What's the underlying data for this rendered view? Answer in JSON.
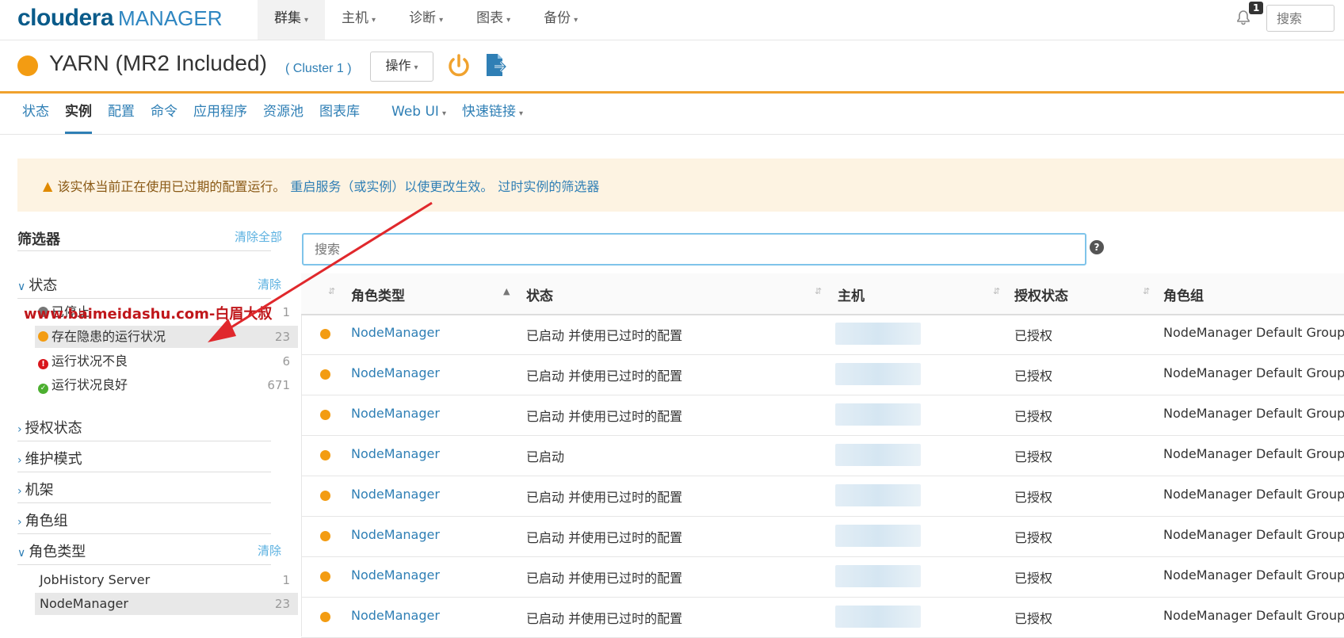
{
  "header": {
    "logo_brand": "cloudera",
    "logo_product": "MANAGER",
    "nav": [
      {
        "label": "群集"
      },
      {
        "label": "主机"
      },
      {
        "label": "诊断"
      },
      {
        "label": "图表"
      },
      {
        "label": "备份"
      }
    ],
    "notification_count": "1",
    "search_placeholder": "搜索"
  },
  "service": {
    "title": "YARN (MR2 Included)",
    "cluster": "( Cluster 1 )",
    "actions_label": "操作",
    "status_color": "#f39c12"
  },
  "tabs": [
    {
      "label": "状态"
    },
    {
      "label": "实例"
    },
    {
      "label": "配置"
    },
    {
      "label": "命令"
    },
    {
      "label": "应用程序"
    },
    {
      "label": "资源池"
    },
    {
      "label": "图表库"
    },
    {
      "label": "Web UI"
    },
    {
      "label": "快速链接"
    }
  ],
  "warning": {
    "text": "该实体当前正在使用已过期的配置运行。",
    "link1": "重启服务（或实例）以使更改生效。",
    "link2": "过时实例的筛选器"
  },
  "sidebar": {
    "title": "筛选器",
    "clear_all": "清除全部",
    "clear": "清除",
    "status_section": "状态",
    "status_items": [
      {
        "label": "已停止",
        "count": "1"
      },
      {
        "label": "存在隐患的运行状况",
        "count": "23"
      },
      {
        "label": "运行状况不良",
        "count": "6"
      },
      {
        "label": "运行状况良好",
        "count": "671"
      }
    ],
    "sections": [
      "授权状态",
      "维护模式",
      "机架",
      "角色组"
    ],
    "role_type_section": "角色类型",
    "role_types": [
      {
        "label": "JobHistory Server",
        "count": "1"
      },
      {
        "label": "NodeManager",
        "count": "23"
      }
    ]
  },
  "watermark": "www.baimeidashu.com-白眉大叔",
  "table": {
    "search_placeholder": "搜索",
    "columns": [
      "角色类型",
      "状态",
      "主机",
      "授权状态",
      "角色组"
    ],
    "rows": [
      {
        "role": "NodeManager",
        "status": "已启动 并使用已过时的配置",
        "auth": "已授权",
        "group": "NodeManager Default Group"
      },
      {
        "role": "NodeManager",
        "status": "已启动 并使用已过时的配置",
        "auth": "已授权",
        "group": "NodeManager Default Group"
      },
      {
        "role": "NodeManager",
        "status": "已启动 并使用已过时的配置",
        "auth": "已授权",
        "group": "NodeManager Default Group"
      },
      {
        "role": "NodeManager",
        "status": "已启动",
        "auth": "已授权",
        "group": "NodeManager Default Group"
      },
      {
        "role": "NodeManager",
        "status": "已启动 并使用已过时的配置",
        "auth": "已授权",
        "group": "NodeManager Default Group"
      },
      {
        "role": "NodeManager",
        "status": "已启动 并使用已过时的配置",
        "auth": "已授权",
        "group": "NodeManager Default Group"
      },
      {
        "role": "NodeManager",
        "status": "已启动 并使用已过时的配置",
        "auth": "已授权",
        "group": "NodeManager Default Group"
      },
      {
        "role": "NodeManager",
        "status": "已启动 并使用已过时的配置",
        "auth": "已授权",
        "group": "NodeManager Default Group"
      }
    ]
  }
}
